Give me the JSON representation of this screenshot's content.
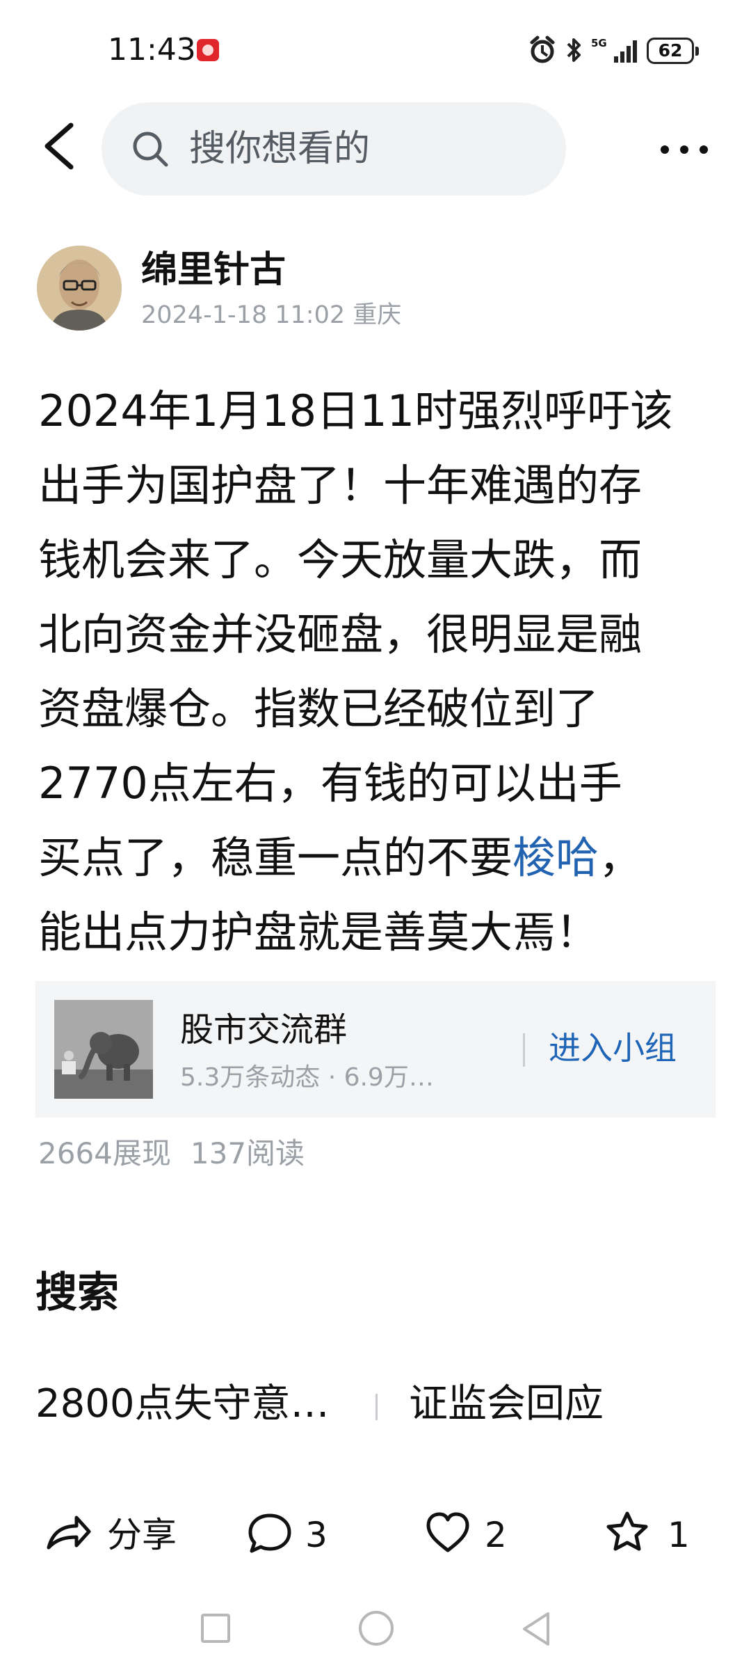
{
  "status_bar": {
    "time": "11:43",
    "network": "5G",
    "battery": "62",
    "icons": [
      "alarm-icon",
      "bluetooth-icon",
      "signal-icon",
      "battery-icon"
    ]
  },
  "top_bar": {
    "search_placeholder": "搜你想看的",
    "icons": [
      "back-arrow-icon",
      "search-icon",
      "more-dots-icon"
    ]
  },
  "post": {
    "author": {
      "name": "绵里针古",
      "meta": "2024-1-18 11:02 重庆",
      "avatar_icon": "avatar-portrait"
    },
    "body_lines": [
      "2024年1月18日11时强烈呼吁该",
      "出手为国护盘了！十年难遇的存",
      "钱机会来了。今天放量大跌，而",
      "北向资金并没砸盘，很明显是融",
      "资盘爆仓。指数已经破位到了",
      "2770点左右，有钱的可以出手"
    ],
    "line_7_prefix": "买点了，稳重一点的不要",
    "line_7_link": "梭哈",
    "line_7_suffix": "，",
    "line_8": "能出点力护盘就是善莫大焉！"
  },
  "group_card": {
    "name": "股市交流群",
    "meta": "5.3万条动态 · 6.9万…",
    "join_label": "进入小组"
  },
  "stats": {
    "impressions": "2664展现",
    "reads": "137阅读"
  },
  "search_section": {
    "title": "搜索",
    "items": [
      "2800点失守意…",
      "证监会回应"
    ]
  },
  "actions": {
    "share_label": "分享",
    "comment_count": "3",
    "like_count": "2",
    "favorite_count": "1"
  },
  "system_nav": [
    "recent-apps-icon",
    "home-icon",
    "back-nav-icon"
  ],
  "colors": {
    "link": "#2163b0",
    "join_button": "#1e64b7",
    "muted_text": "#9ba0a6",
    "search_background": "#f1f2f4",
    "card_background": "#f4f5f7"
  }
}
